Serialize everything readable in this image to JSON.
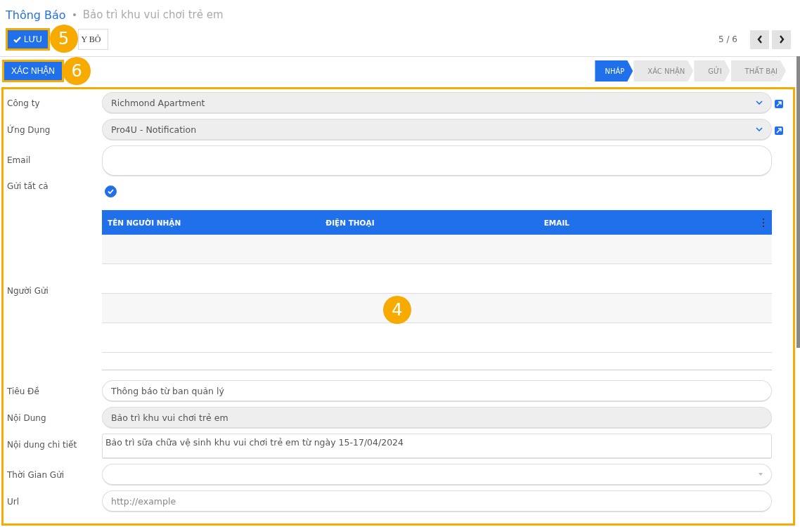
{
  "breadcrumb": {
    "parent": "Thông Báo",
    "current": "Bảo trì khu vui chơi trẻ em"
  },
  "toolbar": {
    "save": {
      "label": "LƯU",
      "callout": "5"
    },
    "discard": {
      "label": "Y BỎ"
    },
    "pager": "5 / 6"
  },
  "statusbar": {
    "confirm": {
      "label": "XÁC NHẬN",
      "callout": "6"
    },
    "stages": [
      {
        "label": "NHÁP",
        "selected": true
      },
      {
        "label": "XÁC NHẬN",
        "selected": false
      },
      {
        "label": "GỬI",
        "selected": false
      },
      {
        "label": "THẤT BẠI",
        "selected": false
      }
    ]
  },
  "form": {
    "callout": "4",
    "fields": [
      {
        "kind": "select",
        "label": "Công ty",
        "value": "Richmond Apartment",
        "readonly": true
      },
      {
        "kind": "select",
        "label": "Ứng Dụng",
        "value": "Pro4U - Notification",
        "readonly": true
      },
      {
        "kind": "email",
        "label": "Email",
        "readonly": false
      },
      {
        "kind": "checkbox",
        "label": "Gửi tất cả",
        "checked": true
      },
      {
        "kind": "table",
        "label": "Người Gửi",
        "columns": [
          "TÊN NGƯỜI NHẬN",
          "ĐIỆN THOẠI",
          "EMAIL"
        ]
      },
      {
        "kind": "input",
        "label": "Tiêu Đề",
        "value": "Thông báo từ ban quản lý",
        "readonly": false
      },
      {
        "kind": "input",
        "label": "Nội Dung",
        "value": "Bảo trì khu vui chơi trẻ em",
        "readonly": true
      },
      {
        "kind": "textarea",
        "label": "Nội dung chi tiết",
        "value": "Bảo trì sữa  chữa vệ sinh khu vui chơi trẻ em từ ngày 15-17/04/2024"
      },
      {
        "kind": "datetime",
        "label": "Thời Gian Gửi",
        "readonly": false
      },
      {
        "kind": "input",
        "label": "Url",
        "placeholder": "http://example",
        "readonly": false
      }
    ]
  }
}
